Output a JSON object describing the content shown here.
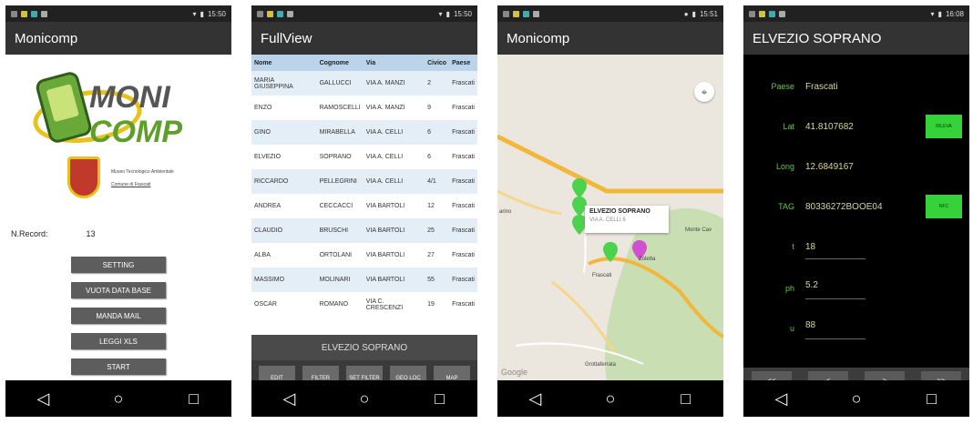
{
  "status_times": [
    "15:50",
    "15:50",
    "15:51",
    "16:08"
  ],
  "nav_icons": [
    "back-triangle",
    "home-circle",
    "recents-square"
  ],
  "screen1": {
    "title": "Monicomp",
    "logo": {
      "line1": "MONI",
      "line2": "COMP"
    },
    "crest_text1": "Museo Tecnologico Ambientale",
    "crest_text2": "Comune di Frascati",
    "record_label": "N.Record:",
    "record_value": "13",
    "buttons": [
      "SETTING",
      "VUOTA DATA BASE",
      "MANDA MAIL",
      "LEGGI XLS",
      "START"
    ]
  },
  "screen2": {
    "title": "FullView",
    "headers": [
      "Nome",
      "Cognome",
      "Via",
      "Civico",
      "Paese"
    ],
    "rows": [
      [
        "MARIA GIUSEPPINA",
        "GALLUCCI",
        "VIA A. MANZI",
        "2",
        "Frascati"
      ],
      [
        "ENZO",
        "RAMOSCELLI",
        "VIA A. MANZI",
        "9",
        "Frascati"
      ],
      [
        "GINO",
        "MIRABELLA",
        "VIA A. CELLI",
        "6",
        "Frascati"
      ],
      [
        "ELVEZIO",
        "SOPRANO",
        "VIA A. CELLI",
        "6",
        "Frascati"
      ],
      [
        "RICCARDO",
        "PELLEGRINI",
        "VIA A. CELLI",
        "4/1",
        "Frascati"
      ],
      [
        "ANDREA",
        "CECCACCI",
        "VIA BARTOLI",
        "12",
        "Frascati"
      ],
      [
        "CLAUDIO",
        "BRUSCHI",
        "VIA BARTOLI",
        "25",
        "Frascati"
      ],
      [
        "ALBA",
        "ORTOLANI",
        "VIA BARTOLI",
        "27",
        "Frascati"
      ],
      [
        "MASSIMO",
        "MOLINARI",
        "VIA BARTOLI",
        "55",
        "Frascati"
      ],
      [
        "OSCAR",
        "ROMANO",
        "VIA C. CRESCENZI",
        "19",
        "Frascati"
      ]
    ],
    "selected": "ELVEZIO SOPRANO",
    "actions": [
      "EDIT",
      "FILTER",
      "SET FILTER",
      "GEO LOC",
      "MAP"
    ]
  },
  "screen3": {
    "title": "Monicomp",
    "info_title": "ELVEZIO SOPRANO",
    "info_sub": "VIA A. CELLI 6",
    "labels": {
      "frascati": "Frascati",
      "grottaferrata": "Grottaferrata",
      "zoletta": "Zoletta",
      "monte": "Monte Cav",
      "marino": "arino"
    },
    "google": "Google"
  },
  "screen4": {
    "title": "ELVEZIO SOPRANO",
    "fields": [
      {
        "label": "Paese",
        "value": "Frascati"
      },
      {
        "label": "Lat",
        "value": "41.8107682"
      },
      {
        "label": "Long",
        "value": "12.6849167"
      },
      {
        "label": "TAG",
        "value": "80336272BOOE04"
      },
      {
        "label": "t",
        "value": "18"
      },
      {
        "label": "ph",
        "value": "5.2"
      },
      {
        "label": "u",
        "value": "88"
      }
    ],
    "rileva_label": "RILEVA",
    "nfc_label": "NFC",
    "nav": [
      "<<",
      "<",
      ">",
      ">>"
    ]
  }
}
